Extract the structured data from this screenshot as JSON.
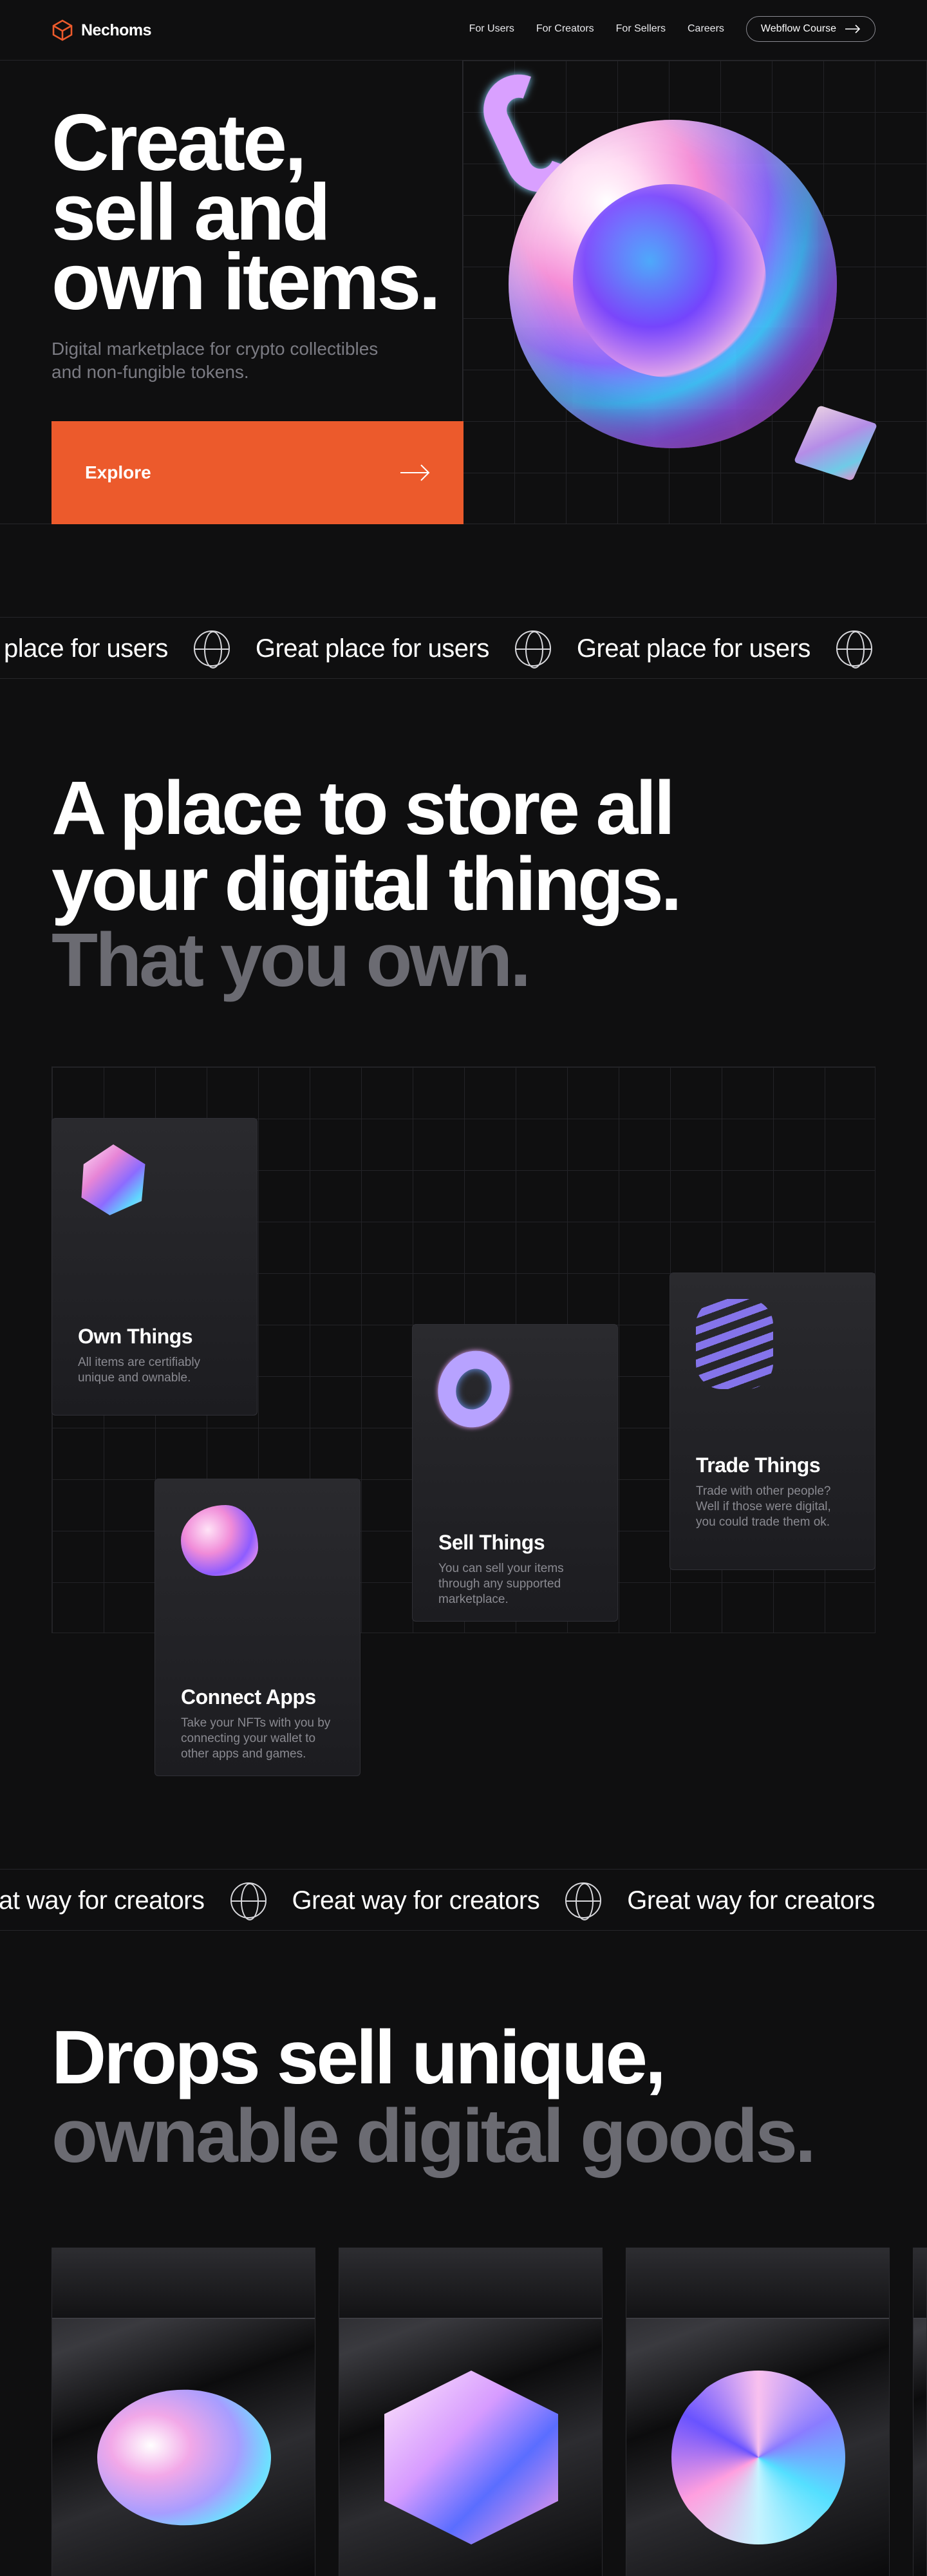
{
  "nav": {
    "brand": "Nechoms",
    "links": [
      "For Users",
      "For Creators",
      "For Sellers",
      "Careers"
    ],
    "cta": "Webflow Course"
  },
  "hero": {
    "title": "Create,\nsell and\nown items.",
    "subtitle": "Digital marketplace for crypto collectibles and non-fungible tokens.",
    "button": "Explore"
  },
  "marquee1": {
    "items": [
      "place for users",
      "Great place for users",
      "Great place for users"
    ]
  },
  "section2": {
    "line1": "A place to store all",
    "line2": "your digital things.",
    "line3": "That you own."
  },
  "features": [
    {
      "title": "Own Things",
      "desc": "All items are certifiably unique and ownable.",
      "icon": "gem-icon"
    },
    {
      "title": "Connect Apps",
      "desc": "Take your NFTs with you by connecting your wallet to other apps and games.",
      "icon": "blob-icon"
    },
    {
      "title": "Sell Things",
      "desc": "You can sell your items through any supported marketplace.",
      "icon": "donut-icon"
    },
    {
      "title": "Trade Things",
      "desc": "Trade with other people? Well if those were digital, you could trade them ok.",
      "icon": "spring-icon"
    }
  ],
  "marquee2": {
    "items": [
      "at way for creators",
      "Great way for creators",
      "Great way for creators"
    ]
  },
  "section3": {
    "line1": "Drops sell unique,",
    "line2": "ownable digital goods."
  },
  "colors": {
    "background": "#0f0f10",
    "accent": "#ec5a2c",
    "muted_text": "#6b6b72"
  }
}
